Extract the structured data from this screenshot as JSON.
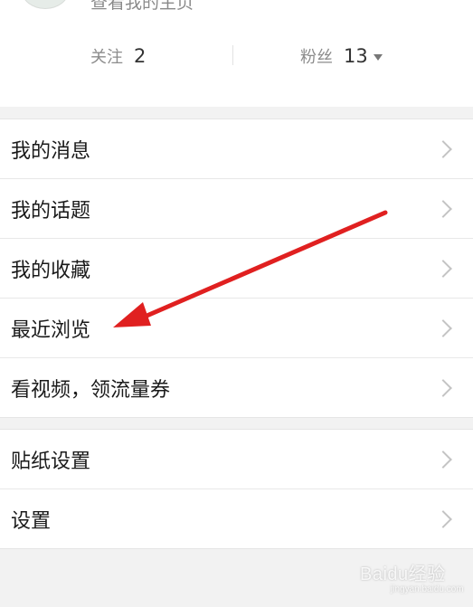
{
  "profile": {
    "link_text": "查看我的主页",
    "following_label": "关注",
    "following_count": "2",
    "fans_label": "粉丝",
    "fans_count": "13"
  },
  "menu_group_1": [
    {
      "label": "我的消息",
      "icon": "chevron-right-icon"
    },
    {
      "label": "我的话题",
      "icon": "chevron-right-icon"
    },
    {
      "label": "我的收藏",
      "icon": "chevron-right-icon"
    },
    {
      "label": "最近浏览",
      "icon": "chevron-right-icon"
    },
    {
      "label": "看视频，领流量券",
      "icon": "chevron-right-icon"
    }
  ],
  "menu_group_2": [
    {
      "label": "贴纸设置",
      "icon": "chevron-right-icon"
    },
    {
      "label": "设置",
      "icon": "chevron-right-icon"
    }
  ],
  "annotation": {
    "color": "#e02020",
    "points_to": "最近浏览"
  },
  "watermark": {
    "text": "Baidu经验",
    "sub": "jingyan.baidu.com"
  }
}
